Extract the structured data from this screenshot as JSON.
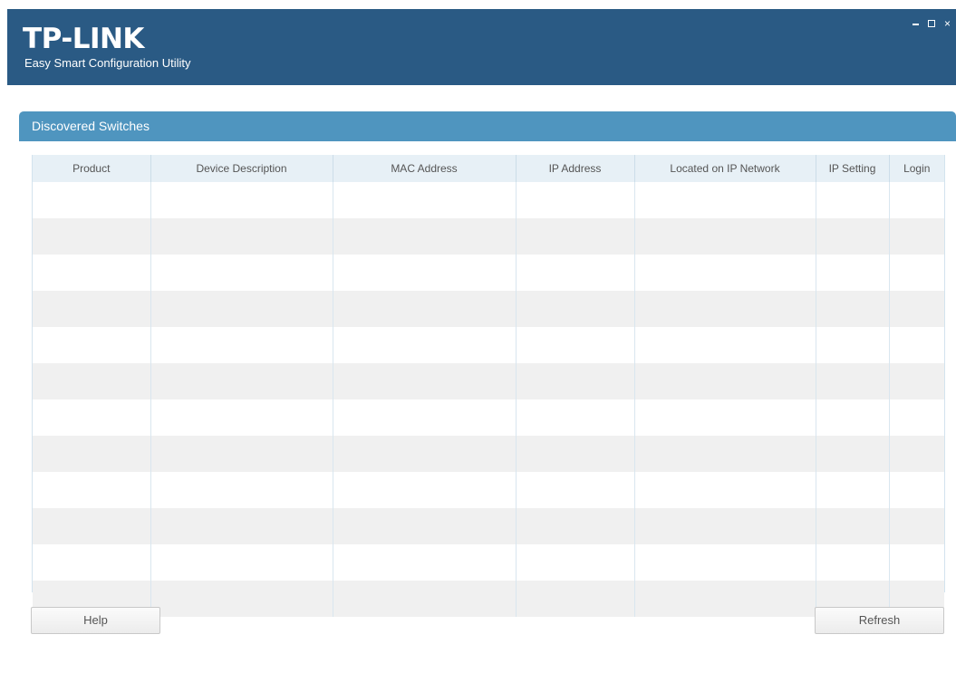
{
  "app": {
    "logo_text": "TP-LINK",
    "subtitle": "Easy Smart Configuration Utility",
    "titlebar_color": "#2a5a84"
  },
  "window_controls": {
    "minimize_icon": "minimize-icon",
    "maximize_icon": "maximize-icon",
    "close_glyph": "×"
  },
  "panel": {
    "title": "Discovered Switches",
    "header_color": "#4f95bf"
  },
  "table": {
    "columns": [
      "Product",
      "Device Description",
      "MAC Address",
      "IP Address",
      "Located on IP Network",
      "IP Setting",
      "Login"
    ],
    "row_count": 12
  },
  "buttons": {
    "help": "Help",
    "refresh": "Refresh"
  }
}
